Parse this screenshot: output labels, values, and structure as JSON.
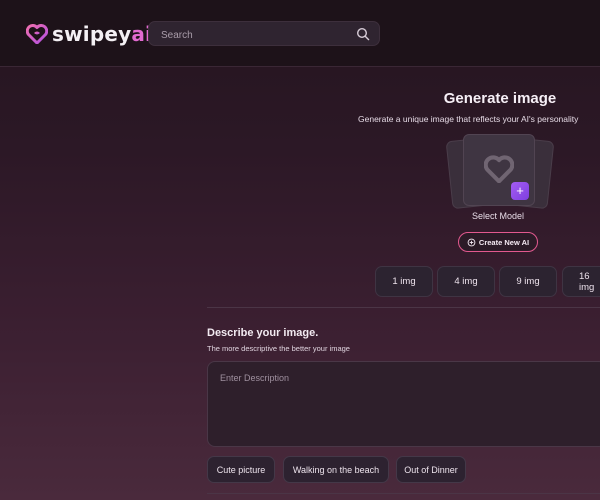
{
  "header": {
    "logo_prefix": "swipey",
    "logo_suffix": "ai",
    "search_placeholder": "Search"
  },
  "generate": {
    "title": "Generate image",
    "subtitle": "Generate a unique image that reflects your AI's personality",
    "select_model_label": "Select Model",
    "add_button_label": "+",
    "create_ai_label": "Create New AI",
    "image_counts": [
      "1 img",
      "4 img",
      "9 img",
      "16 img"
    ]
  },
  "describe": {
    "title": "Describe your image.",
    "subtitle": "The more descriptive the better your image",
    "placeholder": "Enter Description",
    "suggestions": [
      "Cute picture",
      "Walking on the beach",
      "Out of Dinner"
    ]
  },
  "colors": {
    "accent_pink": "#e26ad0",
    "accent_purple": "#9a55ee",
    "create_border": "#e2598f"
  }
}
